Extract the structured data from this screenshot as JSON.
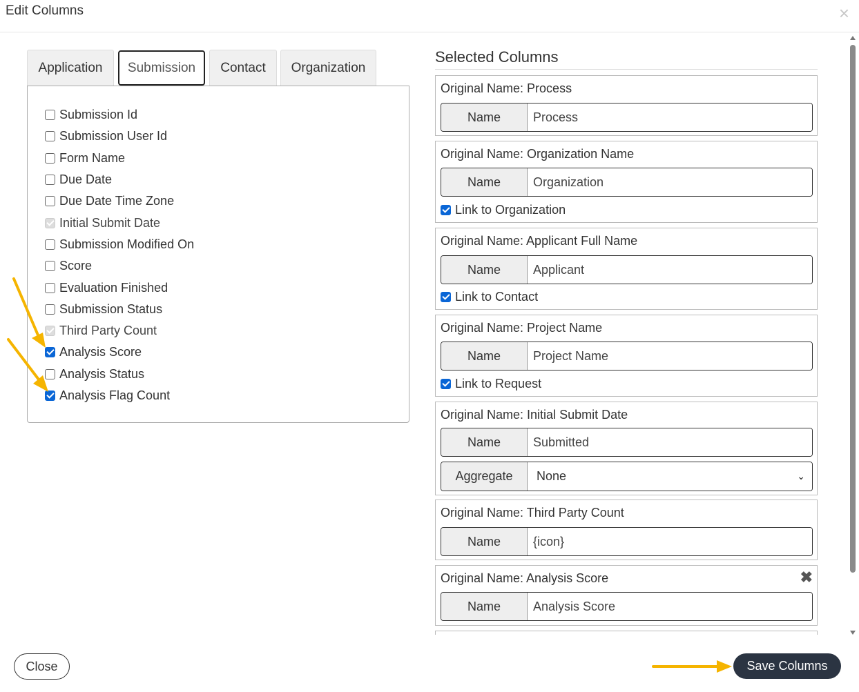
{
  "modal": {
    "title": "Edit Columns",
    "close_glyph": "×"
  },
  "tabs": [
    {
      "label": "Application",
      "active": false
    },
    {
      "label": "Submission",
      "active": true
    },
    {
      "label": "Contact",
      "active": false
    },
    {
      "label": "Organization",
      "active": false
    }
  ],
  "fields": [
    {
      "label": "Submission Id",
      "state": "unchecked"
    },
    {
      "label": "Submission User Id",
      "state": "unchecked"
    },
    {
      "label": "Form Name",
      "state": "unchecked"
    },
    {
      "label": "Due Date",
      "state": "unchecked"
    },
    {
      "label": "Due Date Time Zone",
      "state": "unchecked"
    },
    {
      "label": "Initial Submit Date",
      "state": "disabled"
    },
    {
      "label": "Submission Modified On",
      "state": "unchecked"
    },
    {
      "label": "Score",
      "state": "unchecked"
    },
    {
      "label": "Evaluation Finished",
      "state": "unchecked"
    },
    {
      "label": "Submission Status",
      "state": "unchecked"
    },
    {
      "label": "Third Party Count",
      "state": "disabled"
    },
    {
      "label": "Analysis Score",
      "state": "checked"
    },
    {
      "label": "Analysis Status",
      "state": "unchecked"
    },
    {
      "label": "Analysis Flag Count",
      "state": "checked"
    }
  ],
  "selected": {
    "title": "Selected Columns",
    "name_addon": "Name",
    "aggregate_addon": "Aggregate",
    "columns": [
      {
        "original": "Original Name: Process",
        "name": "Process"
      },
      {
        "original": "Original Name: Organization Name",
        "name": "Organization",
        "link": "Link to Organization"
      },
      {
        "original": "Original Name: Applicant Full Name",
        "name": "Applicant",
        "link": "Link to Contact"
      },
      {
        "original": "Original Name: Project Name",
        "name": "Project Name",
        "link": "Link to Request"
      },
      {
        "original": "Original Name: Initial Submit Date",
        "name": "Submitted",
        "aggregate": "None"
      },
      {
        "original": "Original Name: Third Party Count",
        "name": "{icon}"
      },
      {
        "original": "Original Name: Analysis Score",
        "name": "Analysis Score",
        "removable": true
      }
    ]
  },
  "footer": {
    "close_label": "Close",
    "save_label": "Save Columns"
  },
  "colors": {
    "accent_arrow": "#f5b400",
    "save_button": "#2b3442",
    "checkbox": "#0a66d6"
  }
}
